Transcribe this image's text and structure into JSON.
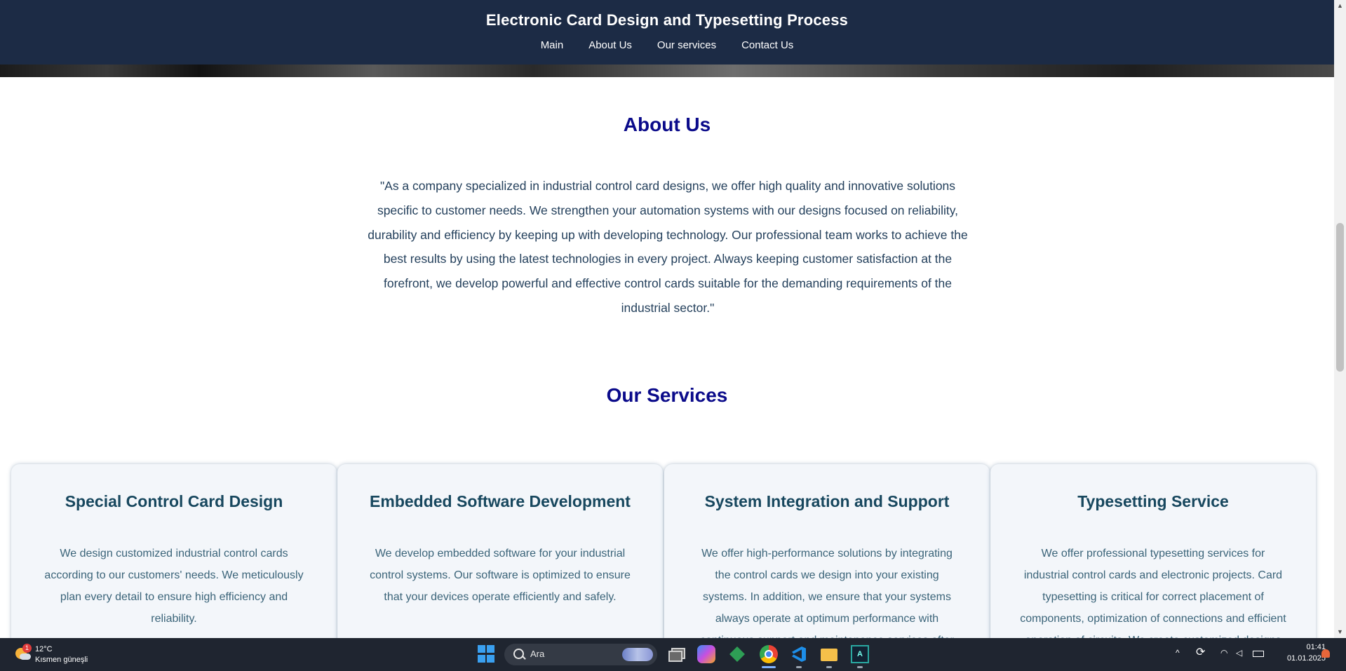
{
  "header": {
    "title": "Electronic Card Design and Typesetting Process",
    "nav": [
      "Main",
      "About Us",
      "Our services",
      "Contact Us"
    ]
  },
  "about": {
    "title": "About Us",
    "text": "\"As a company specialized in industrial control card designs, we offer high quality and innovative solutions specific to customer needs. We strengthen your automation systems with our designs focused on reliability, durability and efficiency by keeping up with developing technology. Our professional team works to achieve the best results by using the latest technologies in every project. Always keeping customer satisfaction at the forefront, we develop powerful and effective control cards suitable for the demanding requirements of the industrial sector.\""
  },
  "services": {
    "title": "Our Services",
    "cards": [
      {
        "title": "Special Control Card Design",
        "text": "We design customized industrial control cards according to our customers' needs. We meticulously plan every detail to ensure high efficiency and reliability."
      },
      {
        "title": "Embedded Software Development",
        "text": "We develop embedded software for your industrial control systems. Our software is optimized to ensure that your devices operate efficiently and safely."
      },
      {
        "title": "System Integration and Support",
        "text": "We offer high-performance solutions by integrating the control cards we design into your existing systems. In addition, we ensure that your systems always operate at optimum performance with continuous support and maintenance services after installation."
      },
      {
        "title": "Typesetting Service",
        "text": "We offer professional typesetting services for industrial control cards and electronic projects. Card typesetting is critical for correct placement of components, optimization of connections and efficient operation of circuits. We create customized designs according"
      }
    ]
  },
  "taskbar": {
    "weather": {
      "badge": "1",
      "temp": "12°C",
      "condition": "Kısmen güneşli"
    },
    "search_placeholder": "Ara",
    "tray": {
      "chevron": "^",
      "time": "01:41",
      "date": "01.01.2025"
    }
  },
  "colors": {
    "header_bg": "#1c2b45",
    "section_title": "#0a0a8a",
    "body_text": "#24405c",
    "card_title": "#17475e",
    "card_bg": "#f3f6fa",
    "taskbar_bg": "#1f2530"
  }
}
